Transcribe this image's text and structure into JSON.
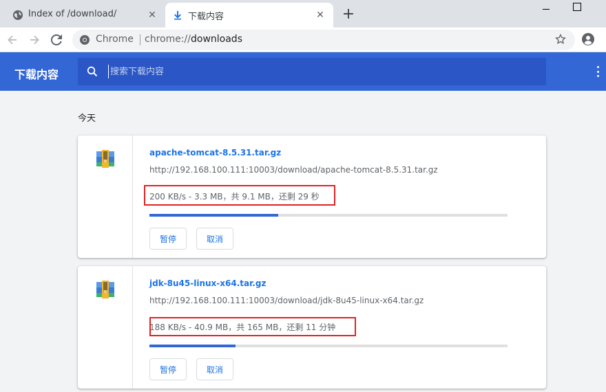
{
  "tabs": [
    {
      "title": "Index of /download/",
      "icon": "globe-icon"
    },
    {
      "title": "下载内容",
      "icon": "download-icon"
    }
  ],
  "toolbar": {
    "chip": "Chrome",
    "url_scheme": "chrome://",
    "url_path": "downloads"
  },
  "header": {
    "title": "下载内容",
    "search_placeholder": "搜索下载内容"
  },
  "section_label": "今天",
  "downloads": [
    {
      "filename": "apache-tomcat-8.5.31.tar.gz",
      "url": "http://192.168.100.111:10003/download/apache-tomcat-8.5.31.tar.gz",
      "status": "200 KB/s - 3.3 MB，共 9.1 MB，还剩 29 秒",
      "progress": 0.36,
      "pause_label": "暂停",
      "cancel_label": "取消"
    },
    {
      "filename": "jdk-8u45-linux-x64.tar.gz",
      "url": "http://192.168.100.111:10003/download/jdk-8u45-linux-x64.tar.gz",
      "status": "188 KB/s - 40.9 MB，共 165 MB，还剩 11 分钟",
      "progress": 0.24,
      "pause_label": "暂停",
      "cancel_label": "取消"
    }
  ],
  "colors": {
    "header_bg": "#3367d6",
    "search_bg": "#2a56c6",
    "link": "#1a73e8",
    "highlight_box": "#e02020"
  }
}
